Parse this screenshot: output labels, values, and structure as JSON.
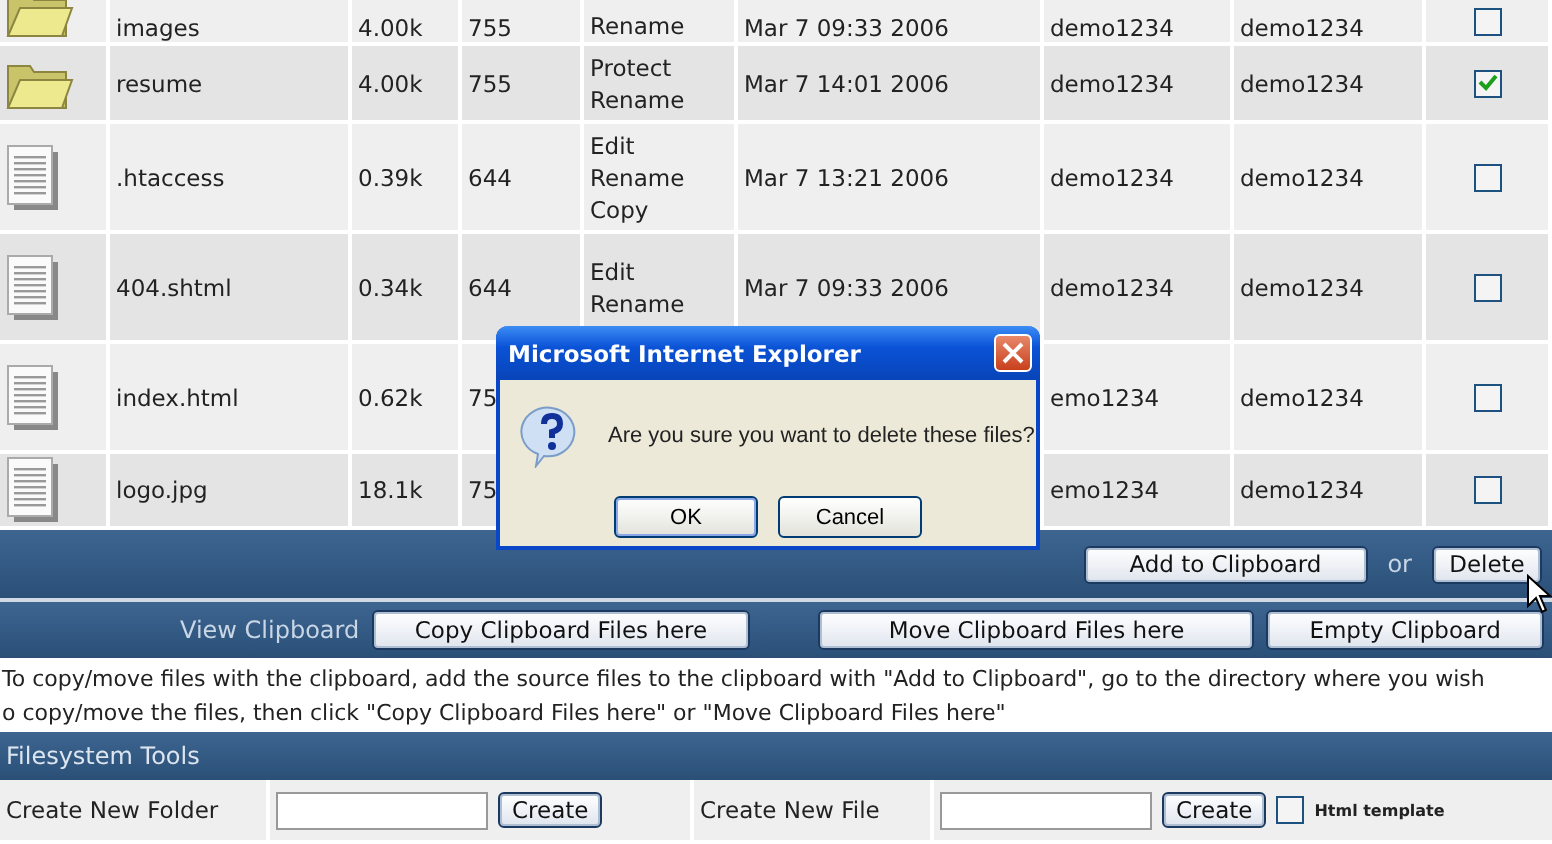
{
  "file_table": {
    "rows": [
      {
        "kind": "folder",
        "name": "images",
        "size": "4.00k",
        "perms": "755",
        "actions": [
          "Rename"
        ],
        "date": "Mar 7 09:33 2006",
        "owner": "demo1234",
        "group": "demo1234",
        "checked": false
      },
      {
        "kind": "folder",
        "name": "resume",
        "size": "4.00k",
        "perms": "755",
        "actions": [
          "Protect",
          "Rename"
        ],
        "date": "Mar 7 14:01 2006",
        "owner": "demo1234",
        "group": "demo1234",
        "checked": true
      },
      {
        "kind": "file",
        "name": ".htaccess",
        "size": "0.39k",
        "perms": "644",
        "actions": [
          "Edit",
          "Rename",
          "Copy"
        ],
        "date": "Mar 7 13:21 2006",
        "owner": "demo1234",
        "group": "demo1234",
        "checked": false
      },
      {
        "kind": "file",
        "name": "404.shtml",
        "size": "0.34k",
        "perms": "644",
        "actions": [
          "Edit",
          "Rename"
        ],
        "date": "Mar 7 09:33 2006",
        "owner": "demo1234",
        "group": "demo1234",
        "checked": false
      },
      {
        "kind": "file",
        "name": "index.html",
        "size": "0.62k",
        "perms": "75",
        "actions": [],
        "owner": "emo1234",
        "group": "demo1234",
        "checked": false
      },
      {
        "kind": "file",
        "name": "logo.jpg",
        "size": "18.1k",
        "perms": "75",
        "actions": [],
        "owner": "emo1234",
        "group": "demo1234",
        "checked": false
      }
    ]
  },
  "selection_bar": {
    "add_button": "Add to Clipboard",
    "or": "or",
    "delete_button": "Delete"
  },
  "clipboard_bar": {
    "label": "View Clipboard",
    "buttons": [
      "Copy Clipboard Files here",
      "Move Clipboard Files here",
      "Empty Clipboard"
    ]
  },
  "help_lines": [
    "To copy/move files with the clipboard, add the source files to the clipboard with \"Add to Clipboard\", go to the directory where you wish",
    "o copy/move the files, then click \"Copy Clipboard Files here\" or \"Move Clipboard Files here\""
  ],
  "tools": {
    "title": "Filesystem Tools",
    "new_folder": {
      "label": "Create New Folder",
      "button": "Create"
    },
    "new_file": {
      "label": "Create New File",
      "button": "Create",
      "template_label": "Html template",
      "template_checked": false
    }
  },
  "dialog": {
    "title": "Microsoft Internet Explorer",
    "message": "Are you sure you want to delete these files?",
    "buttons": [
      "OK",
      "Cancel"
    ]
  }
}
